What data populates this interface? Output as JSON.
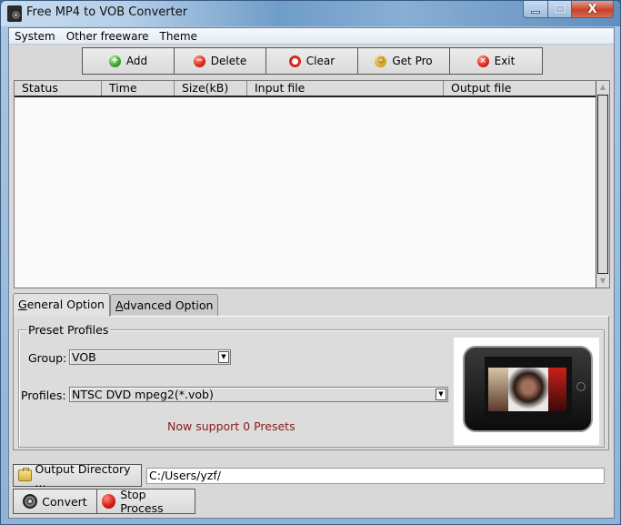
{
  "window": {
    "title": "Free MP4 to VOB Converter",
    "controls": {
      "minimize": "minimize",
      "maximize": "maximize",
      "close": "X"
    }
  },
  "menu": [
    {
      "label": "System"
    },
    {
      "label": "Other freeware"
    },
    {
      "label": "Theme"
    }
  ],
  "toolbar": [
    {
      "label": "Add",
      "icon": "add-icon",
      "glyph": "+"
    },
    {
      "label": "Delete",
      "icon": "delete-icon",
      "glyph": "−"
    },
    {
      "label": "Clear",
      "icon": "clear-icon",
      "glyph": ""
    },
    {
      "label": "Get Pro",
      "icon": "smiley-icon",
      "glyph": "☺"
    },
    {
      "label": "Exit",
      "icon": "exit-icon",
      "glyph": "×"
    }
  ],
  "file_list": {
    "columns": [
      "Status",
      "Time",
      "Size(kB)",
      "Input file",
      "Output file"
    ],
    "rows": []
  },
  "tabs": [
    {
      "label": "General Option",
      "mnemonic": "G",
      "rest": "eneral Option",
      "active": true
    },
    {
      "label": "Advanced Option",
      "mnemonic": "A",
      "rest": "dvanced Option",
      "active": false
    }
  ],
  "preset": {
    "group_title": "Preset Profiles",
    "group_label": "Group:",
    "group_value": "VOB",
    "profiles_label": "Profiles:",
    "profiles_value": "NTSC DVD mpeg2(*.vob)",
    "note": "Now support 0 Presets",
    "note_color": "#8b1a1a"
  },
  "output": {
    "button_label": "Output Directory ...",
    "path": "C:/Users/yzf/"
  },
  "actions": {
    "convert_label": "Convert",
    "stop_label": "Stop Process"
  }
}
